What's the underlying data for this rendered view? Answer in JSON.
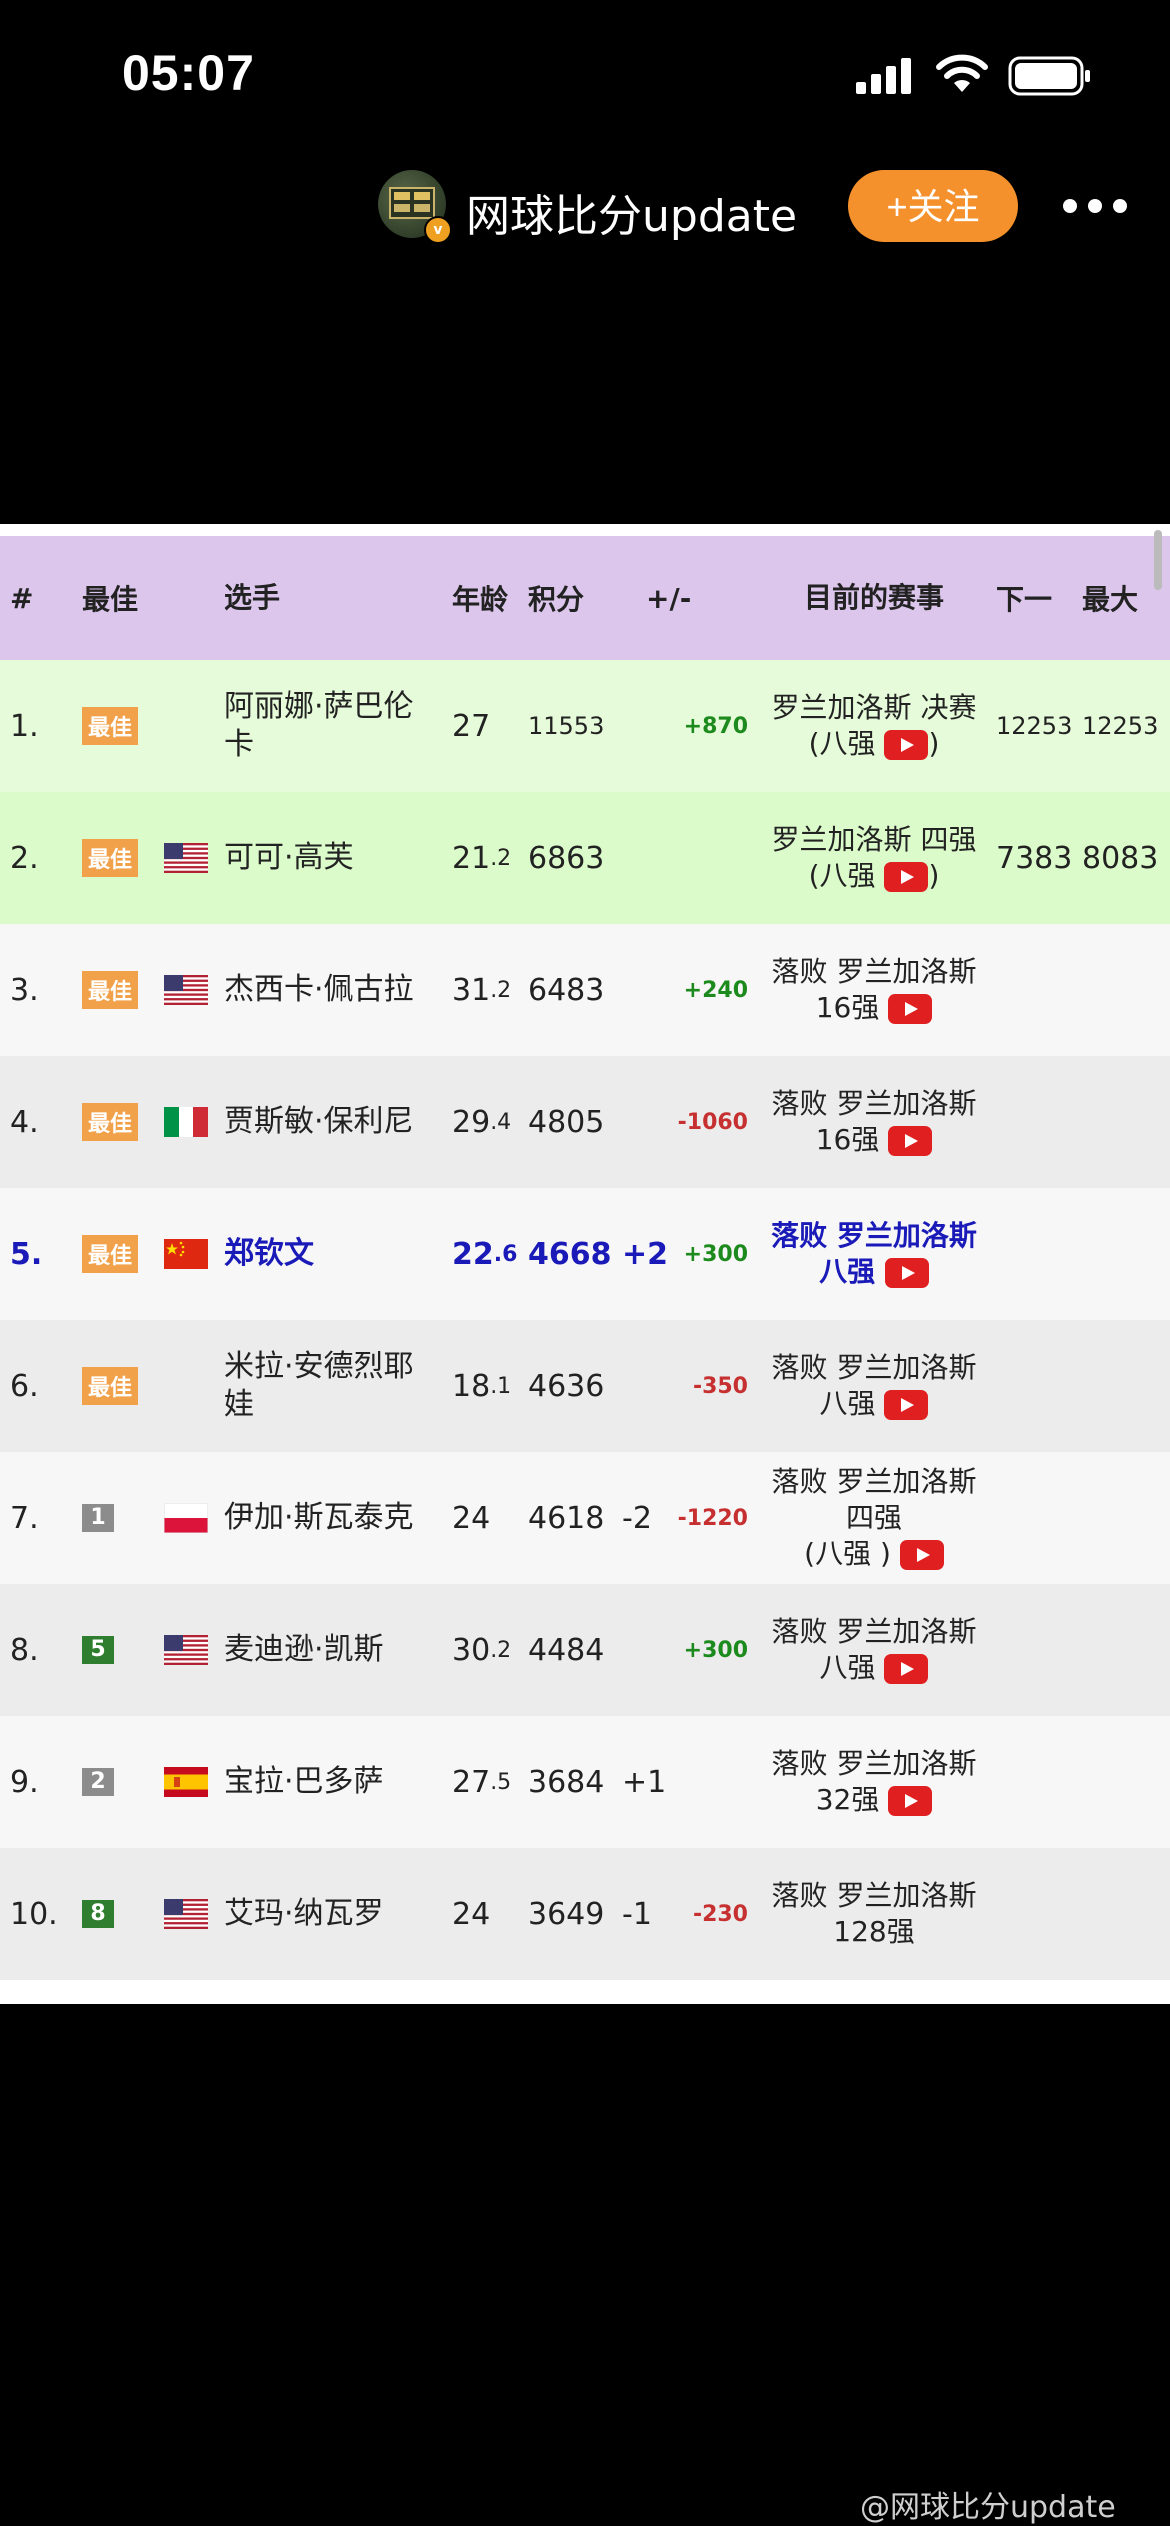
{
  "status_bar": {
    "time": "05:07"
  },
  "header": {
    "channel_name": "网球比分update",
    "follow_label": "+关注",
    "avatar_badge": "v"
  },
  "table": {
    "columns": [
      "#",
      "最佳",
      "选手",
      "年龄",
      "积分",
      "+/-",
      "目前的赛事",
      "下一",
      "最大"
    ],
    "rows": [
      {
        "rank": "1.",
        "best": "最佳",
        "best_type": "best",
        "flag": "",
        "name": "阿丽娜·萨巴伦卡",
        "age_main": "27",
        "age_sub": "",
        "points": "11553",
        "change": "",
        "delta": "+870",
        "delta_sign": "pos",
        "event_l1": "罗兰加洛斯 决赛",
        "event_l2": "(八强",
        "event_l3": ")",
        "event_video": true,
        "next": "12253",
        "max": "12253",
        "bg": "green"
      },
      {
        "rank": "2.",
        "best": "最佳",
        "best_type": "best",
        "flag": "us",
        "name": "可可·高芙",
        "age_main": "21",
        "age_sub": ".2",
        "points": "6863",
        "change": "",
        "delta": "",
        "delta_sign": "",
        "event_l1": "罗兰加洛斯 四强",
        "event_l2": "(八强",
        "event_l3": ")",
        "event_video": true,
        "next": "7383",
        "max": "8083",
        "bg": "green2"
      },
      {
        "rank": "3.",
        "best": "最佳",
        "best_type": "best",
        "flag": "us",
        "name": "杰西卡·佩古拉",
        "age_main": "31",
        "age_sub": ".2",
        "points": "6483",
        "change": "",
        "delta": "+240",
        "delta_sign": "pos",
        "event_l1": "落败 罗兰加洛斯",
        "event_l2": "16强",
        "event_l3": "",
        "event_video": true,
        "next": "",
        "max": "",
        "bg": "light"
      },
      {
        "rank": "4.",
        "best": "最佳",
        "best_type": "best",
        "flag": "it",
        "name": "贾斯敏·保利尼",
        "age_main": "29",
        "age_sub": ".4",
        "points": "4805",
        "change": "",
        "delta": "-1060",
        "delta_sign": "neg",
        "event_l1": "落败 罗兰加洛斯",
        "event_l2": "16强",
        "event_l3": "",
        "event_video": true,
        "next": "",
        "max": "",
        "bg": "gray"
      },
      {
        "rank": "5.",
        "best": "最佳",
        "best_type": "best",
        "flag": "cn",
        "name": "郑钦文",
        "age_main": "22",
        "age_sub": ".6",
        "points": "4668",
        "change": "+2",
        "delta": "+300",
        "delta_sign": "pos",
        "event_l1": "落败 罗兰加洛斯",
        "event_l2": "八强",
        "event_l3": "",
        "event_video": true,
        "next": "",
        "max": "",
        "bg": "light",
        "highlight": true
      },
      {
        "rank": "6.",
        "best": "最佳",
        "best_type": "best",
        "flag": "",
        "name": "米拉·安德烈耶娃",
        "age_main": "18",
        "age_sub": ".1",
        "points": "4636",
        "change": "",
        "delta": "-350",
        "delta_sign": "neg",
        "event_l1": "落败 罗兰加洛斯",
        "event_l2": "八强",
        "event_l3": "",
        "event_video": true,
        "next": "",
        "max": "",
        "bg": "gray"
      },
      {
        "rank": "7.",
        "best": "1",
        "best_type": "gray",
        "flag": "pl",
        "name": "伊加·斯瓦泰克",
        "age_main": "24",
        "age_sub": "",
        "points": "4618",
        "change": "-2",
        "delta": "-1220",
        "delta_sign": "neg",
        "event_l1": "落败 罗兰加洛斯",
        "event_l2": "四强",
        "event_l3": "(八强 )",
        "event_video": true,
        "next": "",
        "max": "",
        "bg": "light"
      },
      {
        "rank": "8.",
        "best": "5",
        "best_type": "green",
        "flag": "us",
        "name": "麦迪逊·凯斯",
        "age_main": "30",
        "age_sub": ".2",
        "points": "4484",
        "change": "",
        "delta": "+300",
        "delta_sign": "pos",
        "event_l1": "落败 罗兰加洛斯",
        "event_l2": "八强",
        "event_l3": "",
        "event_video": true,
        "next": "",
        "max": "",
        "bg": "gray"
      },
      {
        "rank": "9.",
        "best": "2",
        "best_type": "gray",
        "flag": "es",
        "name": "宝拉·巴多萨",
        "age_main": "27",
        "age_sub": ".5",
        "points": "3684",
        "change": "+1",
        "delta": "",
        "delta_sign": "",
        "event_l1": "落败 罗兰加洛斯",
        "event_l2": "32强",
        "event_l3": "",
        "event_video": true,
        "next": "",
        "max": "",
        "bg": "light"
      },
      {
        "rank": "10.",
        "best": "8",
        "best_type": "green",
        "flag": "us",
        "name": "艾玛·纳瓦罗",
        "age_main": "24",
        "age_sub": "",
        "points": "3649",
        "change": "-1",
        "delta": "-230",
        "delta_sign": "neg",
        "event_l1": "落败 罗兰加洛斯",
        "event_l2": "128强",
        "event_l3": "",
        "event_video": false,
        "next": "",
        "max": "",
        "bg": "gray"
      }
    ]
  },
  "watermark": "@网球比分update",
  "icons": {
    "signal": "signal-bars-icon",
    "wifi": "wifi-icon",
    "battery": "battery-icon",
    "more": "more-dots-icon",
    "video": "youtube-play-icon"
  },
  "colors": {
    "follow": "#f5912c",
    "header_row": "#dcc6ec",
    "best_badge": "#f1a14a",
    "highlight": "#1a1ab8",
    "positive": "#1d8a1d",
    "negative": "#c73030"
  }
}
